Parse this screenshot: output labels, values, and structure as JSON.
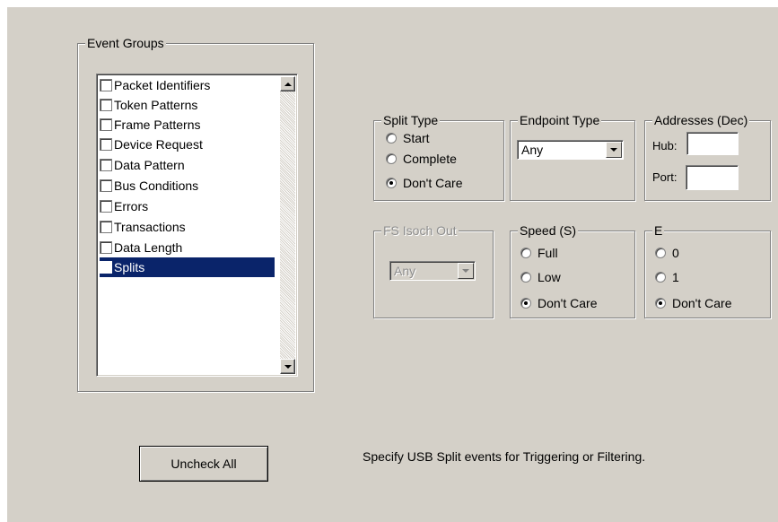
{
  "event_groups": {
    "title": "Event Groups",
    "items": [
      {
        "label": "Packet Identifiers",
        "checked": false
      },
      {
        "label": "Token Patterns",
        "checked": false
      },
      {
        "label": "Frame Patterns",
        "checked": false
      },
      {
        "label": "Device Request",
        "checked": false
      },
      {
        "label": "Data Pattern",
        "checked": false
      },
      {
        "label": "Bus Conditions",
        "checked": false
      },
      {
        "label": "Errors",
        "checked": false
      },
      {
        "label": "Transactions",
        "checked": false
      },
      {
        "label": "Data Length",
        "checked": false
      },
      {
        "label": "Splits",
        "checked": false,
        "selected": true
      }
    ]
  },
  "split_type": {
    "title": "Split Type",
    "options": [
      "Start",
      "Complete",
      "Don't Care"
    ],
    "selected": "Don't Care"
  },
  "endpoint_type": {
    "title": "Endpoint Type",
    "value": "Any"
  },
  "addresses": {
    "title": "Addresses (Dec)",
    "hub_label": "Hub:",
    "hub_value": "",
    "port_label": "Port:",
    "port_value": ""
  },
  "fs_isoch_out": {
    "title": "FS Isoch Out",
    "value": "Any",
    "disabled": true
  },
  "speed": {
    "title": "Speed (S)",
    "options": [
      "Full",
      "Low",
      "Don't Care"
    ],
    "selected": "Don't Care"
  },
  "e_group": {
    "title": "E",
    "options": [
      "0",
      "1",
      "Don't Care"
    ],
    "selected": "Don't Care"
  },
  "uncheck_all_label": "Uncheck All",
  "status_text": "Specify USB Split events for Triggering or Filtering.",
  "colors": {
    "background": "#d4d0c8",
    "selection": "#0a246a"
  }
}
